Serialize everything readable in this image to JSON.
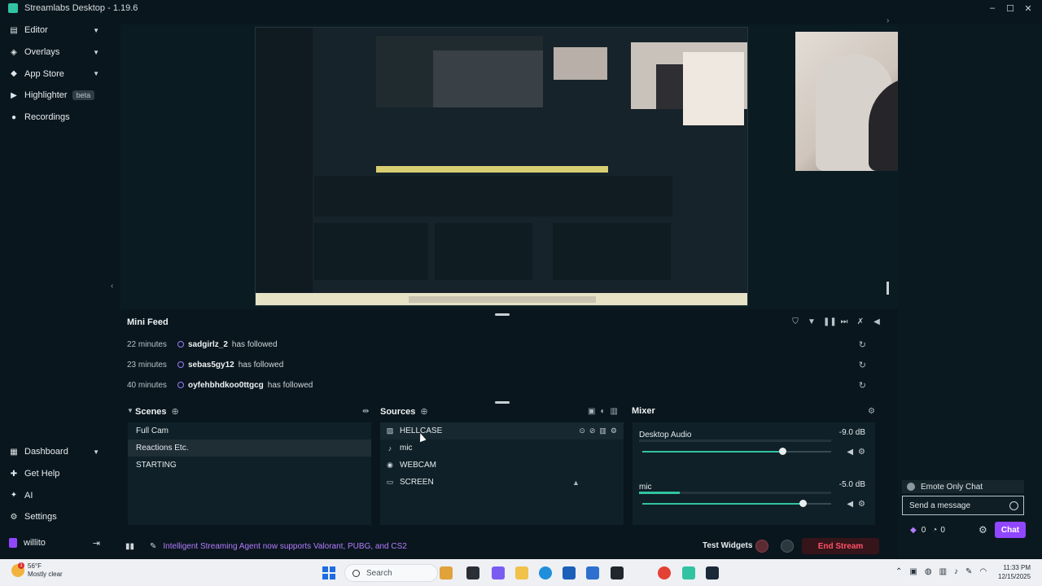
{
  "window": {
    "title": "Streamlabs Desktop - 1.19.6",
    "controls": [
      "–",
      "☐",
      "✕"
    ]
  },
  "sidebar": {
    "items": [
      {
        "label": "Editor",
        "icon": "editor-icon",
        "chevron": true
      },
      {
        "label": "Overlays",
        "icon": "overlays-icon",
        "chevron": true
      },
      {
        "label": "App Store",
        "icon": "app-store-icon",
        "chevron": true
      },
      {
        "label": "Highlighter",
        "icon": "highlighter-icon",
        "badge": "beta"
      },
      {
        "label": "Recordings",
        "icon": "recordings-icon"
      }
    ],
    "bottom_items": [
      {
        "label": "Dashboard",
        "icon": "dashboard-icon",
        "chevron": true
      },
      {
        "label": "Get Help",
        "icon": "help-icon"
      },
      {
        "label": "AI",
        "icon": "ai-icon"
      },
      {
        "label": "Settings",
        "icon": "settings-icon"
      }
    ],
    "user": "willito"
  },
  "minifeed": {
    "title": "Mini Feed",
    "events": [
      {
        "time": "22 minutes",
        "name": "sadgirlz_2",
        "action": "has followed"
      },
      {
        "time": "23 minutes",
        "name": "sebas5gy12",
        "action": "has followed"
      },
      {
        "time": "40 minutes",
        "name": "oyfehbhdkoo0ttgcg",
        "action": "has followed"
      }
    ]
  },
  "scenes": {
    "title": "Scenes",
    "items": [
      "Full Cam",
      "Reactions Etc.",
      "STARTING"
    ],
    "active_index": 1
  },
  "sources": {
    "title": "Sources",
    "items": [
      {
        "label": "HELLCASE",
        "icon": "image-icon"
      },
      {
        "label": "mic",
        "icon": "microphone-icon"
      },
      {
        "label": "WEBCAM",
        "icon": "camera-icon"
      },
      {
        "label": "SCREEN",
        "icon": "monitor-icon"
      }
    ]
  },
  "mixer": {
    "title": "Mixer",
    "channels": [
      {
        "name": "Desktop Audio",
        "db": "-9.0 dB",
        "level": 0.0,
        "volume": 0.74
      },
      {
        "name": "mic",
        "db": "-5.0 dB",
        "level": 0.21,
        "volume": 0.85
      }
    ]
  },
  "chat": {
    "emote_only": "Emote Only Chat",
    "placeholder": "Send a message",
    "points": "0",
    "bits": "0",
    "button": "Chat"
  },
  "footer": {
    "announcement": "Intelligent Streaming Agent now supports Valorant, PUBG, and CS2",
    "test_widgets": "Test Widgets",
    "end_stream": "End Stream"
  },
  "taskbar": {
    "weather_temp": "56°F",
    "weather_desc": "Mostly clear",
    "weather_badge": "1",
    "search_label": "Search",
    "time": "11:33 PM",
    "date": "12/15/2025"
  },
  "colors": {
    "accent": "#31c3a2",
    "brand_purple": "#9146ff",
    "end_stream": "#ff5266",
    "background": "#09161d"
  }
}
